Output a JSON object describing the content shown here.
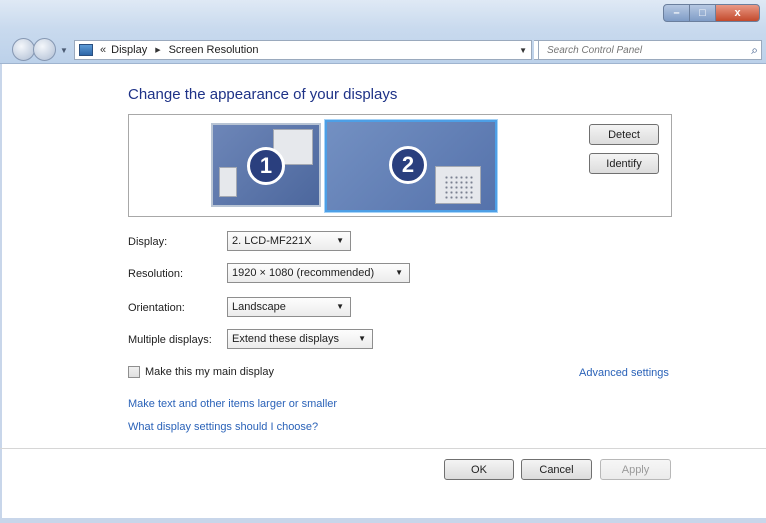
{
  "window": {
    "controls": {
      "minimize": "–",
      "maximize": "□",
      "close": "x"
    }
  },
  "nav": {
    "breadcrumb_prefix": "«",
    "breadcrumbs": [
      "Display",
      "Screen Resolution"
    ],
    "search_placeholder": "Search Control Panel"
  },
  "main": {
    "heading": "Change the appearance of your displays",
    "monitors": [
      {
        "number": "1",
        "selected": false
      },
      {
        "number": "2",
        "selected": true
      }
    ],
    "detect_label": "Detect",
    "identify_label": "Identify",
    "display_label": "Display:",
    "display_value": "2. LCD-MF221X",
    "resolution_label": "Resolution:",
    "resolution_value": "1920 × 1080 (recommended)",
    "orientation_label": "Orientation:",
    "orientation_value": "Landscape",
    "multiple_label": "Multiple displays:",
    "multiple_value": "Extend these displays",
    "main_display_label": "Make this my main display",
    "main_display_checked": false,
    "advanced_link": "Advanced settings",
    "text_size_link": "Make text and other items larger or smaller",
    "help_link": "What display settings should I choose?"
  },
  "footer": {
    "ok_label": "OK",
    "cancel_label": "Cancel",
    "apply_label": "Apply"
  },
  "colors": {
    "heading": "#1e3287",
    "link": "#2a62b8",
    "selected_monitor_border": "#4d9fe6"
  }
}
